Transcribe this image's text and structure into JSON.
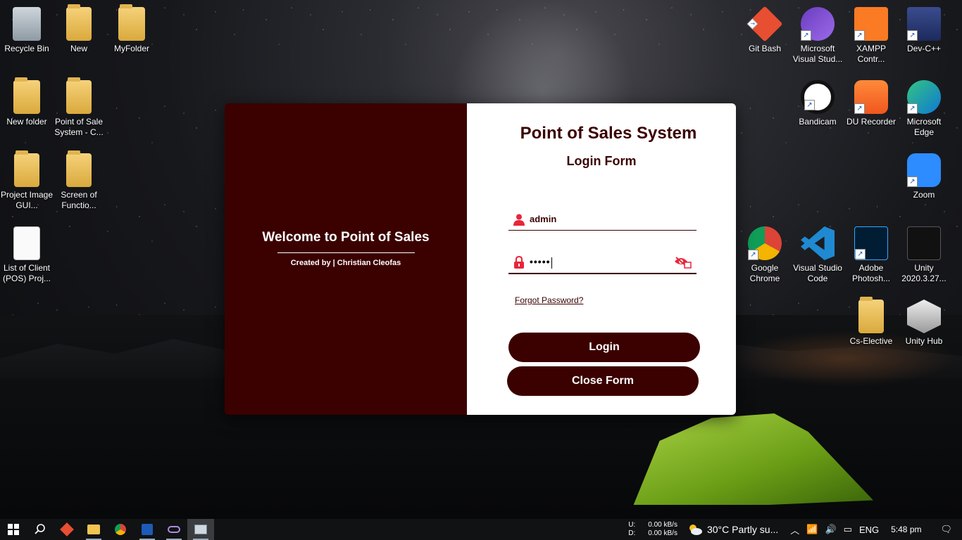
{
  "desktop": {
    "left_icons": [
      {
        "label": "Recycle Bin"
      },
      {
        "label": "New"
      },
      {
        "label": "MyFolder"
      },
      {
        "label": "New folder"
      },
      {
        "label": "Point of Sale System - C..."
      },
      {
        "label": "Project Image GUI..."
      },
      {
        "label": "Screen of Functio..."
      },
      {
        "label": "List of Client (POS) Proj..."
      }
    ],
    "right_icons": [
      {
        "label": "Git Bash"
      },
      {
        "label": "Microsoft Visual Stud..."
      },
      {
        "label": "XAMPP Contr..."
      },
      {
        "label": "Dev-C++"
      },
      {
        "label": "Bandicam"
      },
      {
        "label": "DU Recorder"
      },
      {
        "label": "Microsoft Edge"
      },
      {
        "label": "Zoom"
      },
      {
        "label": "Google Chrome"
      },
      {
        "label": "Visual Studio Code"
      },
      {
        "label": "Adobe Photosh..."
      },
      {
        "label": "Unity 2020.3.27..."
      },
      {
        "label": "Cs-Elective"
      },
      {
        "label": "Unity Hub"
      }
    ]
  },
  "login": {
    "welcome": "Welcome to Point of Sales",
    "credit": "Created by | Christian Cleofas",
    "title": "Point of Sales System",
    "subtitle": "Login Form",
    "username_value": "admin",
    "password_value": "•••••",
    "forgot": "Forgot Password?",
    "login_button": "Login",
    "close_button": "Close Form",
    "accent_color": "#3b0000"
  },
  "taskbar": {
    "net_up_label": "U:",
    "net_down_label": "D:",
    "net_up": "0.00 kB/s",
    "net_down": "0.00 kB/s",
    "weather": "30°C  Partly su...",
    "language": "ENG",
    "time": "5:48 pm"
  }
}
